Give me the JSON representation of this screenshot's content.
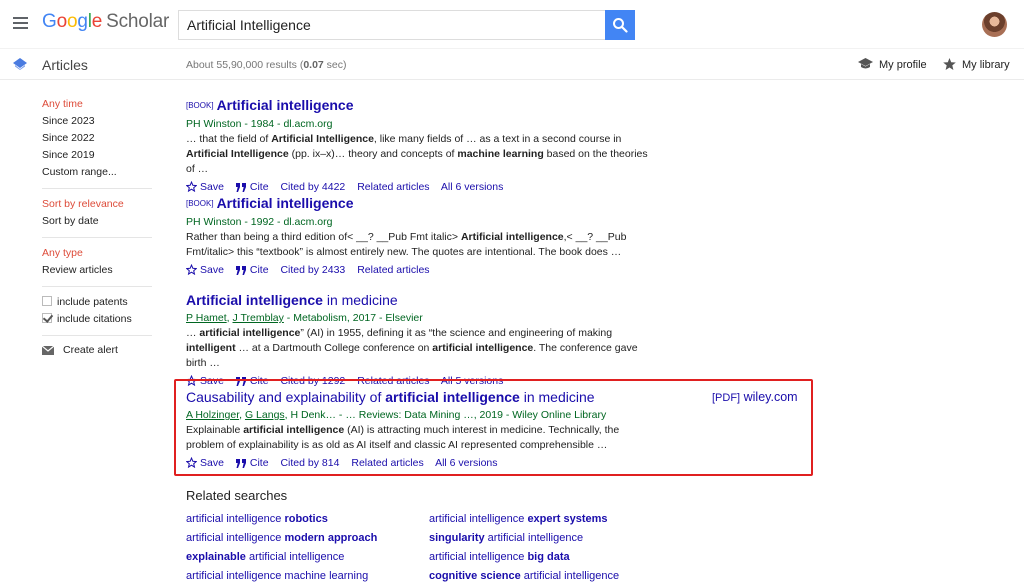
{
  "header": {
    "logo": {
      "g1": "G",
      "g2": "o",
      "g3": "o",
      "g4": "g",
      "g5": "l",
      "g6": "e",
      "scholar": "Scholar"
    },
    "search_value": "Artificial Intelligence"
  },
  "subheader": {
    "section": "Articles",
    "results_prefix": "About 55,90,000 results (",
    "results_time": "0.07",
    "results_suffix": " sec)",
    "my_profile": "My profile",
    "my_library": "My library"
  },
  "sidebar": {
    "time": [
      "Any time",
      "Since 2023",
      "Since 2022",
      "Since 2019",
      "Custom range..."
    ],
    "sort": [
      "Sort by relevance",
      "Sort by date"
    ],
    "type": [
      "Any type",
      "Review articles"
    ],
    "checks": [
      {
        "label": "include patents",
        "checked": false
      },
      {
        "label": "include citations",
        "checked": true
      }
    ],
    "create_alert": "Create alert"
  },
  "results": [
    {
      "tag": "[BOOK]",
      "title": "Artificial intelligence",
      "meta": "PH Winston - 1984 - dl.acm.org",
      "snippet_html": "… that the field of <b>Artificial Intelligence</b>, like many fields of … as a text in a second course in <b>Artificial Intelligence</b> (pp. ix–x)… theory and concepts of <b>machine learning</b> based on the theories of …",
      "links": {
        "save": "Save",
        "cite": "Cite",
        "cited_by": "Cited by 4422",
        "related": "Related articles",
        "versions": "All 6 versions"
      }
    },
    {
      "tag": "[BOOK]",
      "title": "Artificial intelligence",
      "meta": "PH Winston - 1992 - dl.acm.org",
      "snippet_html": "Rather than being a third edition of&lt; __? __Pub Fmt italic&gt; <b>Artificial intelligence</b>,&lt; __? __Pub Fmt/italic&gt; this “textbook” is almost entirely new. The quotes are intentional. The book does …",
      "links": {
        "save": "Save",
        "cite": "Cite",
        "cited_by": "Cited by 2433",
        "related": "Related articles"
      }
    },
    {
      "title_html": "<b>Artificial intelligence</b> in medicine",
      "meta_html": "<u>P Hamet</u>, <u>J Tremblay</u> - Metabolism, 2017 - Elsevier",
      "snippet_html": "… <b>artificial intelligence</b>” (AI) in 1955, defining it as “the science and engineering of making <b>intelligent</b> … at a Dartmouth College conference on <b>artificial intelligence</b>. The conference gave birth …",
      "links": {
        "save": "Save",
        "cite": "Cite",
        "cited_by": "Cited by 1292",
        "related": "Related articles",
        "versions": "All 5 versions"
      }
    },
    {
      "title_html": "Causability and explainability of <b>artificial intelligence</b> in medicine",
      "meta_html": "<u>A Holzinger</u>, <u>G Langs</u>, H Denk… - … Reviews: Data Mining …, 2019 - Wiley Online Library",
      "snippet_html": "Explainable <b>artificial intelligence</b> (AI) is attracting much interest in medicine. Technically, the problem of explainability is as old as AI itself and classic AI represented comprehensible …",
      "links": {
        "save": "Save",
        "cite": "Cite",
        "cited_by": "Cited by 814",
        "related": "Related articles",
        "versions": "All 6 versions"
      },
      "pdf": {
        "tag": "[PDF]",
        "domain": "wiley.com"
      }
    }
  ],
  "related": {
    "title": "Related searches",
    "items_html": [
      "artificial intelligence <b>robotics</b>",
      "artificial intelligence <b>modern approach</b>",
      "<b>explainable</b> artificial intelligence",
      "artificial intelligence machine learning",
      "artificial intelligence <b>expert systems</b>",
      "<b>singularity</b> artificial intelligence",
      "artificial intelligence <b>big data</b>",
      "<b>cognitive science</b> artificial intelligence"
    ]
  },
  "colors": {
    "link": "#1a0dab",
    "meta": "#006621",
    "active": "#dd4b39",
    "search_button": "#4285f4",
    "highlight": "#e02020"
  },
  "icons": [
    "menu-icon",
    "search-icon",
    "avatar",
    "articles-icon",
    "graduation-cap-icon",
    "star-icon",
    "mail-icon",
    "quote-icon"
  ]
}
